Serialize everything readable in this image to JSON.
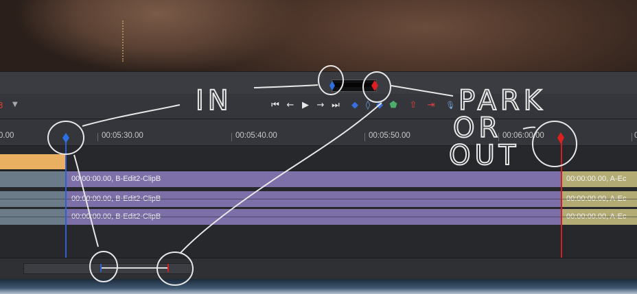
{
  "toolbar": {
    "red_value": "3",
    "caret": "▼",
    "buttons": [
      {
        "name": "go-to-start-button",
        "glyph": "⏮"
      },
      {
        "name": "step-back-button",
        "glyph": "←"
      },
      {
        "name": "play-button",
        "glyph": "▶"
      },
      {
        "name": "step-forward-button",
        "glyph": "→"
      },
      {
        "name": "go-to-end-button",
        "glyph": "⏭"
      },
      {
        "name": "set-in-button",
        "glyph": "◆"
      },
      {
        "name": "clear-marks-button",
        "glyph": "◊"
      },
      {
        "name": "set-out-button",
        "glyph": "◆"
      },
      {
        "name": "marker-button",
        "glyph": "⬟"
      },
      {
        "name": "lift-button",
        "glyph": "⇧"
      },
      {
        "name": "extract-button",
        "glyph": "⇥"
      },
      {
        "name": "mic-button",
        "glyph": "🎙"
      }
    ]
  },
  "ruler": {
    "labels": [
      "0.00",
      "00:05:30.00",
      "00:05:40.00",
      "00:05:50.00",
      "00:06:00.00",
      "0"
    ]
  },
  "tracks": [
    {
      "main": "00:00:00.00, B-Edit2-ClipB",
      "right": "00:00:00.00, A-Ec"
    },
    {
      "main": "00:00:00.00, B-Edit2-ClipB",
      "right": "00:00:00.00, A-Ec"
    },
    {
      "main": "00:00:00.00, B-Edit2-ClipB",
      "right": "00:00:00.00, A-Ec"
    }
  ],
  "annotations": {
    "in": "IN",
    "park": "PARK",
    "or": "OR",
    "out": "OUT"
  },
  "colors": {
    "in_marker": "#2f5fd0",
    "out_marker": "#d02020",
    "clip_main": "#7d6fa8",
    "clip_right": "#b3ab74",
    "orange_track": "#e9b061"
  }
}
